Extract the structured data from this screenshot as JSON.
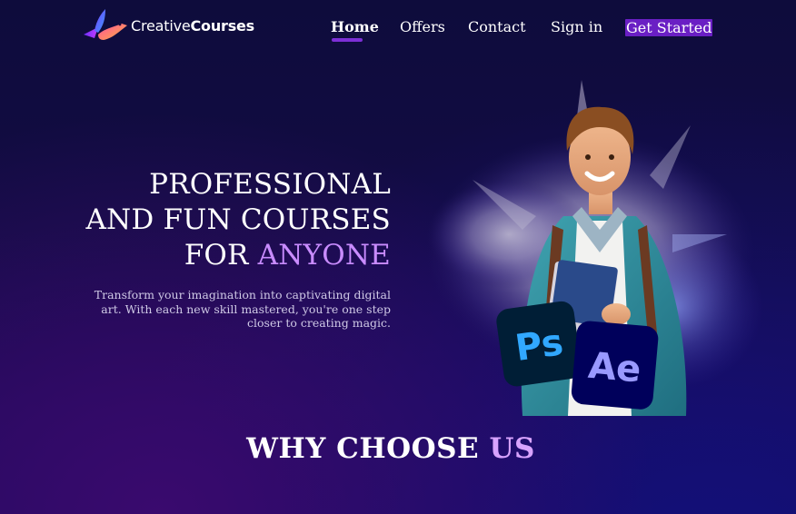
{
  "brand": {
    "name_light": "Creative",
    "name_bold": "Courses",
    "logo_icon": "bird-logo-icon"
  },
  "nav": {
    "items": [
      {
        "label": "Home",
        "active": true
      },
      {
        "label": "Offers",
        "active": false
      },
      {
        "label": "Contact",
        "active": false
      },
      {
        "label": "Sign in",
        "active": false
      }
    ],
    "cta_label": "Get Started"
  },
  "hero": {
    "title_line1": "PROFESSIONAL",
    "title_line2": "AND FUN COURSES",
    "title_line3_plain": "FOR ",
    "title_line3_accent": "ANYONE",
    "description": "Transform your imagination into captivating digital art. With each new skill mastered, you're one step closer to creating magic.",
    "app_badges": [
      {
        "label": "Ps",
        "icon": "photoshop-icon"
      },
      {
        "label": "Ae",
        "icon": "after-effects-icon"
      }
    ]
  },
  "section": {
    "heading_plain": "WHY CHOOSE ",
    "heading_accent": "US"
  },
  "colors": {
    "accent_purple": "#c98cff",
    "cta_background": "#6a1fc4",
    "underline": "#7d2fd6",
    "ps_badge_text": "#31a8ff",
    "ae_badge_text": "#9999ff"
  }
}
